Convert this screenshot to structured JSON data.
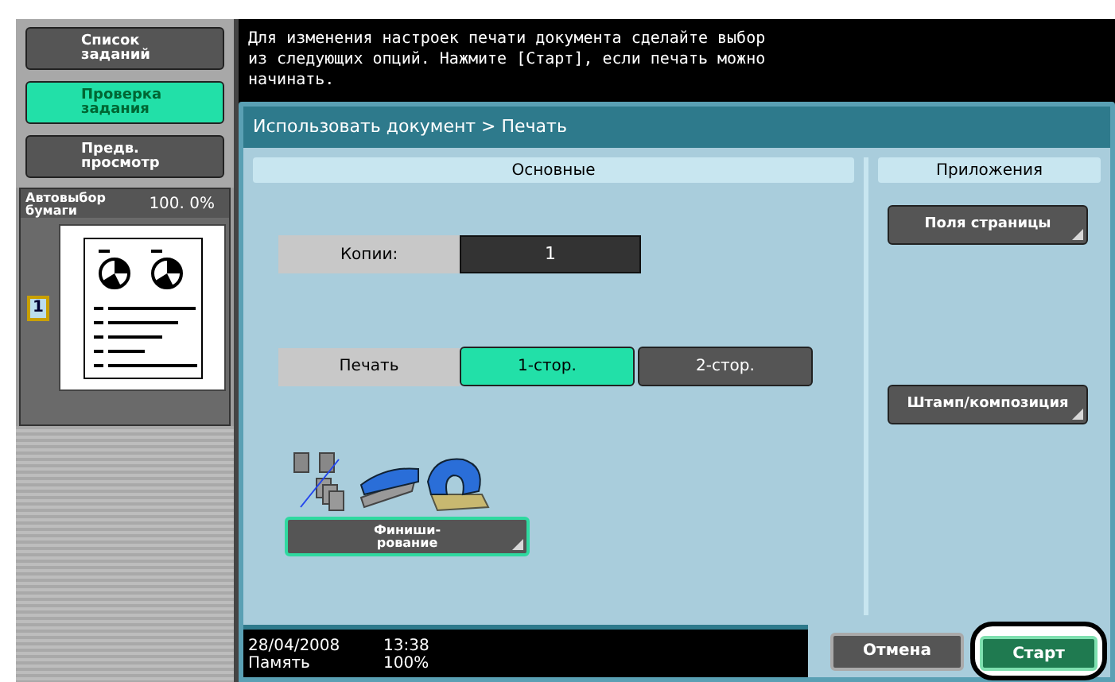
{
  "sidebar": {
    "buttons": [
      {
        "label": "Список\nзаданий",
        "selected": false
      },
      {
        "label": "Проверка\nзадания",
        "selected": true
      },
      {
        "label": "Предв.\nпросмотр",
        "selected": false
      }
    ],
    "paper": {
      "label": "Автовыбор\nбумаги",
      "zoom": "100. 0%",
      "badge": "1"
    }
  },
  "message": "Для изменения настроек печати документа сделайте выбор\nиз следующих опций. Нажмите [Старт], если печать можно\nначинать.",
  "breadcrumb": "Использовать документ > Печать",
  "basic": {
    "title": "Основные",
    "copies": {
      "label": "Копии:",
      "value": "1"
    },
    "print": {
      "label": "Печать",
      "options": [
        {
          "label": "1-стор.",
          "selected": true
        },
        {
          "label": "2-стор.",
          "selected": false
        }
      ]
    },
    "finishing": "Финиши-\nрование"
  },
  "applications": {
    "title": "Приложения",
    "buttons": [
      "Поля страницы",
      "Штамп/композиция"
    ]
  },
  "status": {
    "date": "28/04/2008",
    "time": "13:38",
    "memory_label": "Память",
    "memory": "100%"
  },
  "actions": {
    "cancel": "Отмена",
    "start": "Старт",
    "start_highlighted": true
  }
}
